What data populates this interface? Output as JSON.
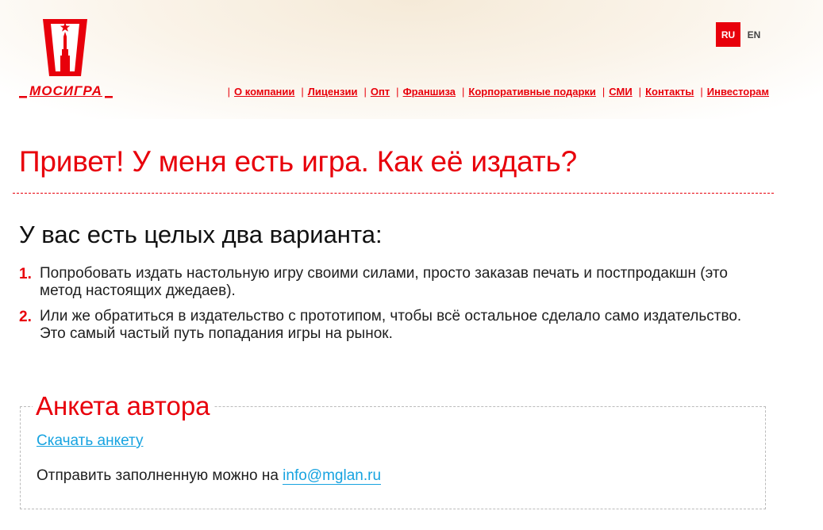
{
  "brand": {
    "logo_text": "МОСИГРА",
    "accent": "#e8000b",
    "link_color": "#17a3e0"
  },
  "lang": {
    "ru": "RU",
    "en": "EN",
    "active": "RU"
  },
  "nav": [
    {
      "label": "О компании"
    },
    {
      "label": "Лицензии"
    },
    {
      "label": "Опт"
    },
    {
      "label": "Франшиза"
    },
    {
      "label": "Корпоративные подарки"
    },
    {
      "label": "СМИ"
    },
    {
      "label": "Контакты"
    },
    {
      "label": "Инвесторам"
    }
  ],
  "page": {
    "title": "Привет! У меня есть игра. Как её издать?",
    "subtitle": "У вас есть целых два варианта:",
    "options": [
      {
        "num": "1.",
        "text": "Попробовать издать настольную игру своими силами, просто заказав печать и постпродакшн (это метод настоящих джедаев)."
      },
      {
        "num": "2.",
        "text": "Или же обратиться в издательство с прототипом, чтобы всё остальное сделало само издательство. Это самый частый путь попадания игры на рынок."
      }
    ]
  },
  "form": {
    "title": "Анкета автора",
    "download_label": "Скачать анкету",
    "send_text": "Отправить заполненную можно на",
    "email": "info@mglan.ru"
  }
}
